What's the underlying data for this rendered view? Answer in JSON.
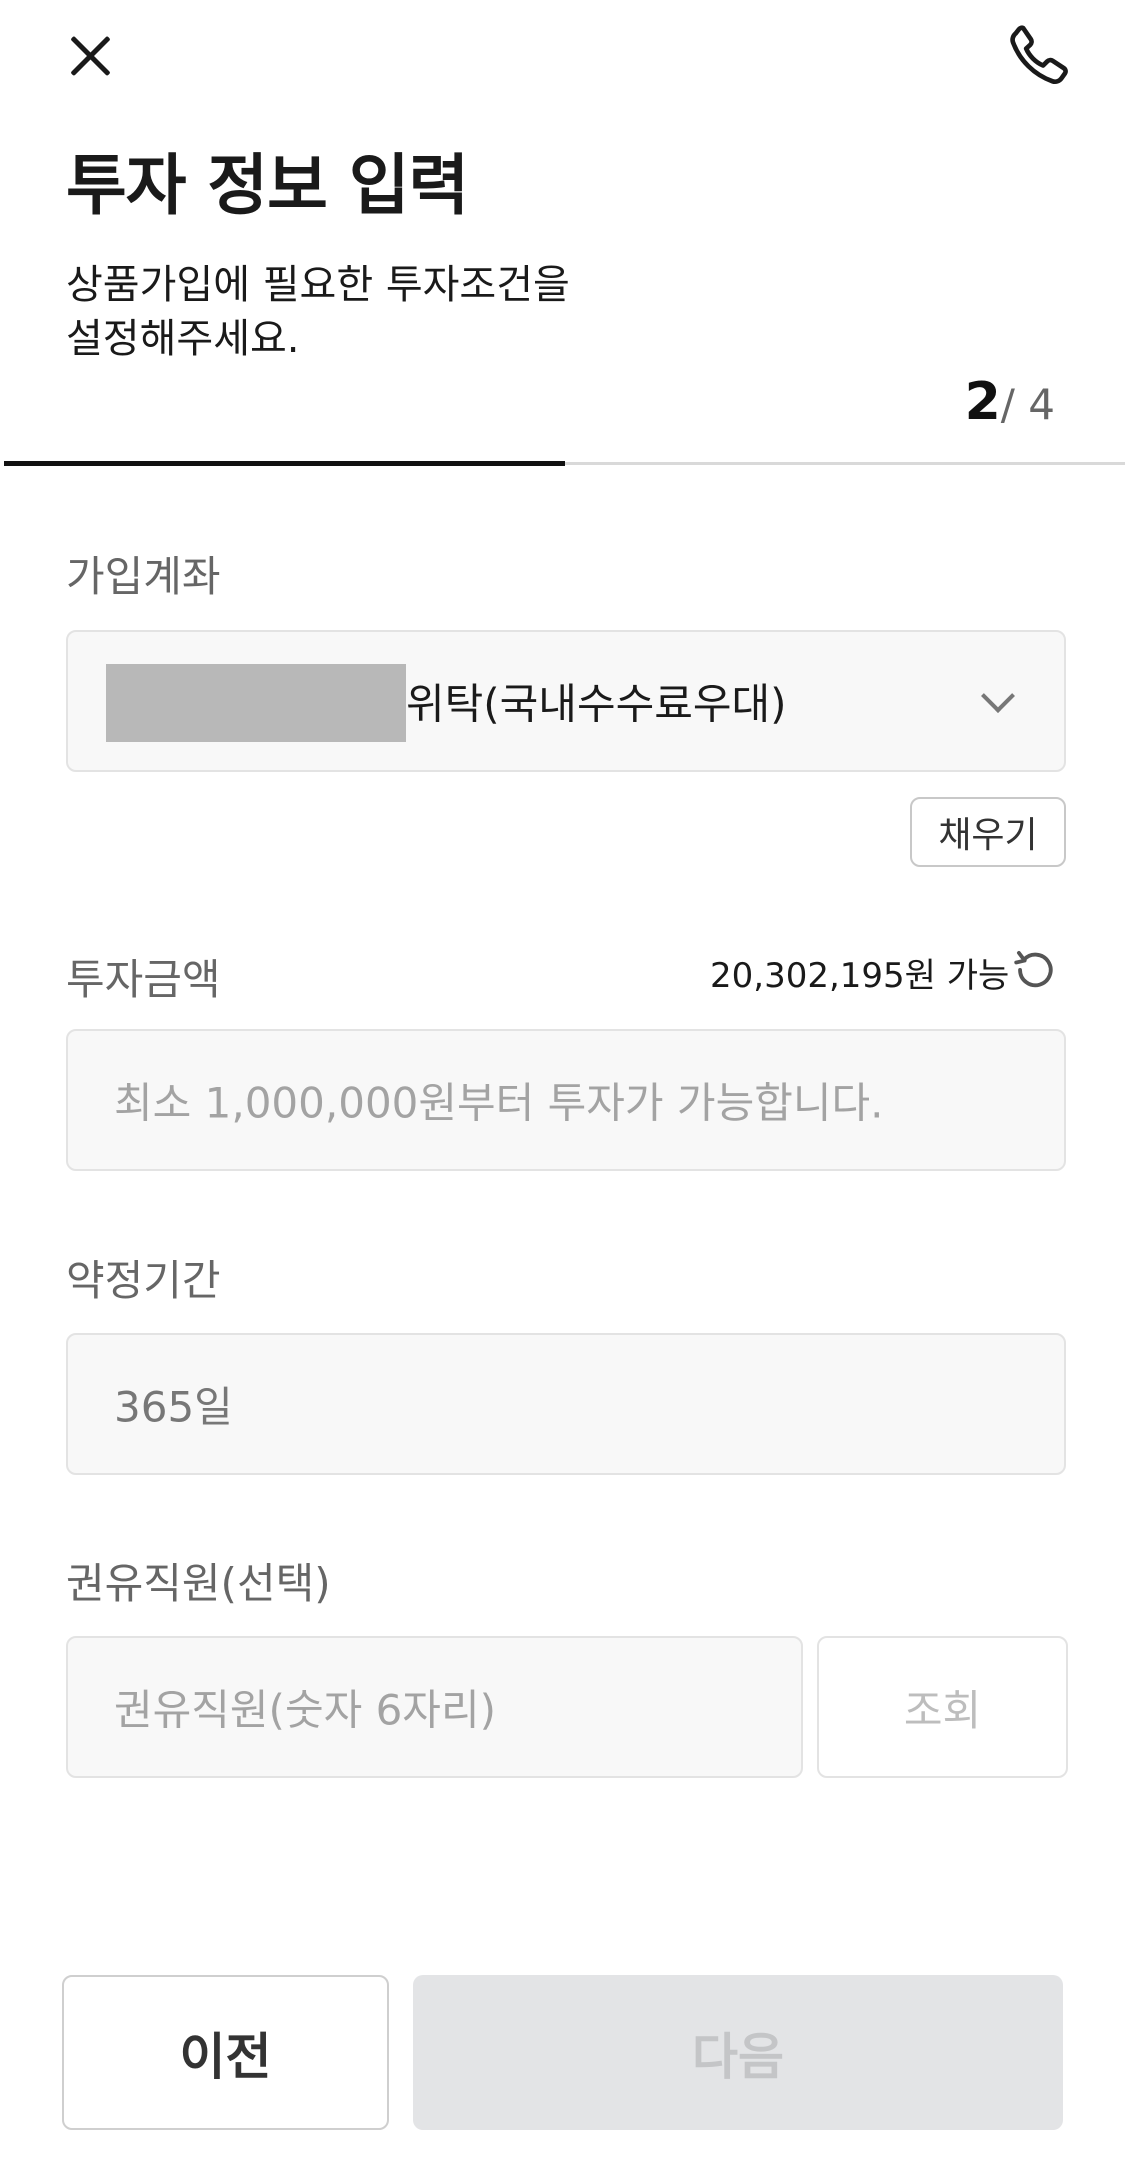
{
  "header": {
    "title": "투자 정보 입력",
    "subtitle": "상품가입에 필요한 투자조건을\n설정해주세요.",
    "step_current": "2",
    "step_total": "/ 4",
    "progress_fraction": 0.5
  },
  "account": {
    "label": "가입계좌",
    "account_name": "위탁(국내수수료우대)",
    "fill_button": "채우기"
  },
  "amount": {
    "label": "투자금액",
    "available": "20,302,195원 가능",
    "placeholder": "최소 1,000,000원부터 투자가 가능합니다."
  },
  "period": {
    "label": "약정기간",
    "value": "365일"
  },
  "recommender": {
    "label": "권유직원(선택)",
    "placeholder": "권유직원(숫자 6자리)",
    "search_button": "조회"
  },
  "footer": {
    "prev_label": "이전",
    "next_label": "다음"
  },
  "icons": {
    "close": "close-icon",
    "phone": "phone-icon",
    "chevron": "chevron-down-icon",
    "refresh": "refresh-icon"
  },
  "colors": {
    "primary_text": "#1a1a1a",
    "label_gray": "#666666",
    "disabled_button_bg": "#e3e4e6",
    "disabled_button_text": "#c4c5c7"
  }
}
